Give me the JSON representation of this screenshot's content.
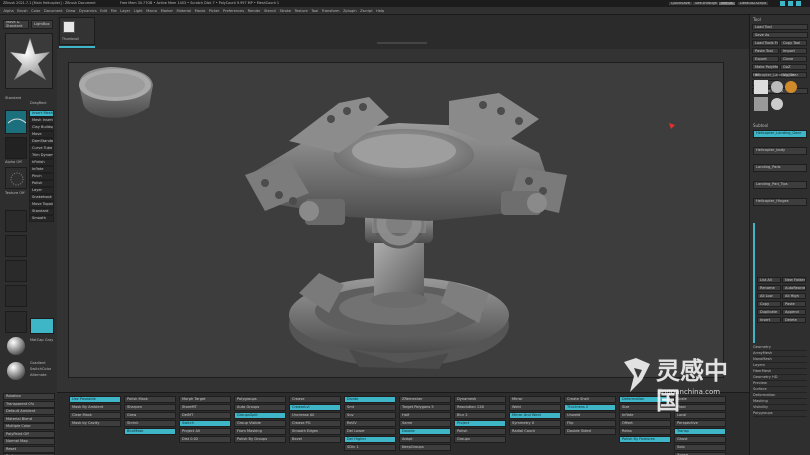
{
  "titlebar": {
    "app_title": "ZBrush 2021.7.1 [Main Helicopter] : ZBrush Document",
    "info": "Free Mem 30.77GB • Active Mem 1403 • Scratch Disk 7 • PolyCount 9.997 MP • MeshCount 1",
    "quicksave": "QuickSave",
    "see_through": "See-through 0",
    "menus_btn": "Menus",
    "default_script": "DefaultZScript"
  },
  "menubar": {
    "items": [
      "Alpha",
      "Brush",
      "Color",
      "Document",
      "Draw",
      "Dynamics",
      "Edit",
      "File",
      "Layer",
      "Light",
      "Macro",
      "Marker",
      "Material",
      "Movie",
      "Picker",
      "Preferences",
      "Render",
      "Stencil",
      "Stroke",
      "Texture",
      "Tool",
      "Transform",
      "Zplugin",
      "Zscript",
      "Help"
    ]
  },
  "left": {
    "brush_label": "Move & Standard",
    "lightbox": "LightBox",
    "brush_name": "Standard",
    "stroke_label": "DragRect",
    "alpha_label": "Alpha Off",
    "texture_label": "Texture Off",
    "material_label": "MatCap Gray",
    "menu_items": [
      "Insert Mesh",
      "Mesh Insert Dot",
      "Clay Buildup",
      "Move",
      "DamStandard",
      "Curve Tube",
      "Trim Dynamic",
      "hPolish",
      "Inflate",
      "Pinch",
      "Polish",
      "Layer",
      "Snakehook",
      "Move Topological",
      "Standard",
      "Smooth"
    ],
    "gradient_label": "Gradient",
    "switch_color": "SwitchColor",
    "alternate": "Alternate",
    "bottom_items": [
      "Rotation",
      "Transparent 0%",
      "Default Ambient",
      "Material Blend",
      "Multiple Color",
      "PolyPaint Off",
      "Normal Map",
      "Reset",
      "Preferences"
    ]
  },
  "top_shelf": {
    "projection_label": "Projection Master",
    "lightbox_label": "LightBox",
    "thumbnail_label": "Thumbnail"
  },
  "canvas": {
    "note": ""
  },
  "right": {
    "header": "Tool",
    "buttons": [
      "Load Tool",
      "Save As",
      "Load Tools From Project",
      "Copy Tool",
      "Paste Tool",
      "Import",
      "Export",
      "Clone",
      "Make PolyMesh3D",
      "GoZ",
      "All",
      "Visible",
      "R",
      "Lightbox › Tools"
    ],
    "tool_name": "Helicopter_Landing_Gear",
    "subtool_header": "Subtool",
    "subtools": [
      "Helicopter_Landing_Gear",
      "Helicopter_body",
      "Landing_Pads",
      "Landing_Pad_Tips",
      "Helicopter_Hinges"
    ],
    "lower_buttons": [
      "List All",
      "New Folder",
      "Rename",
      "AutoReorder",
      "All Low",
      "All High",
      "Copy",
      "Paste",
      "Duplicate",
      "Append",
      "Insert",
      "Delete",
      "Del Other",
      "Del All",
      "Split",
      "Merge",
      "Boolean",
      "Align",
      "Distribute",
      "Remesh",
      "Project",
      "Extract"
    ],
    "sections": [
      "Geometry",
      "ArrayMesh",
      "NanoMesh",
      "Layers",
      "FiberMesh",
      "Geometry HD",
      "Preview",
      "Surface",
      "Deformation",
      "Masking",
      "Visibility",
      "Polygroups",
      "Contact",
      "Morph Target",
      "Polypaint",
      "UV Map",
      "Texture Map",
      "Displacement Map",
      "Normal Map",
      "Vector Displacement Map",
      "Display Properties",
      "Unified Skin",
      "Initialize",
      "Import",
      "Export"
    ]
  },
  "bottom": {
    "col1": [
      "Use Poseable",
      "Mask By Ambient",
      "Clear Mask",
      "Mask by Cavity"
    ],
    "col2": [
      "Polish Mask",
      "Sharpen",
      "Grow",
      "Shrink",
      "BlurMask"
    ],
    "col3": [
      "Morph Target",
      "StoreMT",
      "DelMT",
      "Switch",
      "Project All",
      "Dist 0.02"
    ],
    "col4": [
      "Polygroups",
      "Auto Groups",
      "GroupsSplit",
      "Group Visible",
      "From Masking",
      "Polish By Groups"
    ],
    "col5": [
      "Crease",
      "CreaseLvl",
      "Uncrease All",
      "Crease PG",
      "Smooth Edges",
      "Bevel"
    ],
    "col6": [
      "Divide",
      "Smt",
      "Suv",
      "ReUV",
      "Del Lower",
      "Del Higher",
      "SDiv 1"
    ],
    "col7": [
      "ZRemesher",
      "Target Polygons 5",
      "Half",
      "Same",
      "Double",
      "Adapt",
      "KeepGroups"
    ],
    "col8": [
      "Dynamesh",
      "Resolution 128",
      "Blur 2",
      "Project",
      "Polish",
      "Groups"
    ],
    "col9": [
      "Mirror",
      "Weld",
      "Mirror And Weld",
      "Symmetry X",
      "Radial Count"
    ],
    "col10": [
      "Create Shell",
      "Thickness 2",
      "Unweld",
      "Flip",
      "Double Sided"
    ],
    "col11": [
      "Deformation",
      "Size",
      "Inflate",
      "Offset",
      "Relax",
      "Polish By Features"
    ],
    "col12": [
      "Scale",
      "Floor",
      "Local",
      "Perspective",
      "Transp",
      "Ghost",
      "Solo",
      "Xpose"
    ]
  },
  "icons": {
    "brush_star": "star-brush-icon",
    "material_sphere": "material-sphere-icon",
    "watermark_logo": "lingganchina-logo-icon"
  },
  "watermark": {
    "cn": "灵感中国",
    "url": "lingganchina.com"
  },
  "colors": {
    "accent": "#3fb5c8",
    "bg": "#2a2a2a",
    "canvas": "#3d3d3d",
    "cursor": "#e03030"
  }
}
